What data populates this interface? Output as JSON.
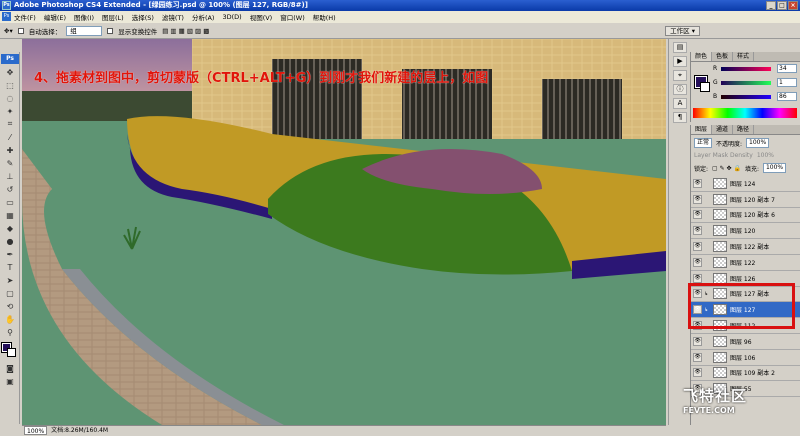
{
  "window": {
    "title": "Adobe Photoshop CS4 Extended - [绿园练习.psd @ 100% (图层 127, RGB/8#)]"
  },
  "menu": [
    "文件(F)",
    "编辑(E)",
    "图像(I)",
    "图层(L)",
    "选择(S)",
    "滤镜(T)",
    "分析(A)",
    "3D(D)",
    "视图(V)",
    "窗口(W)",
    "帮助(H)"
  ],
  "options": {
    "auto_select_label": "自动选择：",
    "auto_select_value": "组",
    "show_transform_label": "显示变换控件",
    "workspace": "工作区 ▾"
  },
  "canvas": {
    "caption": "4、拖素材到图中，剪切蒙版（CTRL+ALT+G）到刚才我们新建的层上，如图"
  },
  "status": {
    "zoom": "100%",
    "doc": "文档:8.26M/160.4M"
  },
  "color_panel": {
    "tabs": [
      "颜色",
      "色板",
      "样式"
    ],
    "r": "34",
    "g": "1",
    "b": "86",
    "r_label": "R",
    "g_label": "G",
    "b_label": "B",
    "fg_color": "#25105a"
  },
  "layers_panel": {
    "tabs": [
      "图层",
      "通道",
      "路径"
    ],
    "blend_mode": "正常",
    "opacity_label": "不透明度:",
    "opacity": "100%",
    "mask_density": "Layer Mask Density",
    "mask_density_value": "100%",
    "lock_label": "锁定:",
    "fill_label": "填充:",
    "fill": "100%",
    "layers": [
      {
        "name": "图层 124",
        "selected": false,
        "clipped": false
      },
      {
        "name": "图层 120 副本 7",
        "selected": false,
        "clipped": false
      },
      {
        "name": "图层 120 副本 6",
        "selected": false,
        "clipped": false
      },
      {
        "name": "图层 120",
        "selected": false,
        "clipped": false
      },
      {
        "name": "图层 122 副本",
        "selected": false,
        "clipped": false
      },
      {
        "name": "图层 122",
        "selected": false,
        "clipped": false
      },
      {
        "name": "图层 126",
        "selected": false,
        "clipped": false
      },
      {
        "name": "图层 127 副本",
        "selected": false,
        "clipped": true
      },
      {
        "name": "图层 127",
        "selected": true,
        "clipped": true
      },
      {
        "name": "图层 112",
        "selected": false,
        "clipped": false
      },
      {
        "name": "图层 96",
        "selected": false,
        "clipped": false
      },
      {
        "name": "图层 106",
        "selected": false,
        "clipped": false
      },
      {
        "name": "图层 109 副本 2",
        "selected": false,
        "clipped": false
      },
      {
        "name": "图层 55",
        "selected": false,
        "clipped": false
      }
    ]
  },
  "watermark": {
    "text": "飞特社区",
    "sub": "FEVTE.COM"
  }
}
